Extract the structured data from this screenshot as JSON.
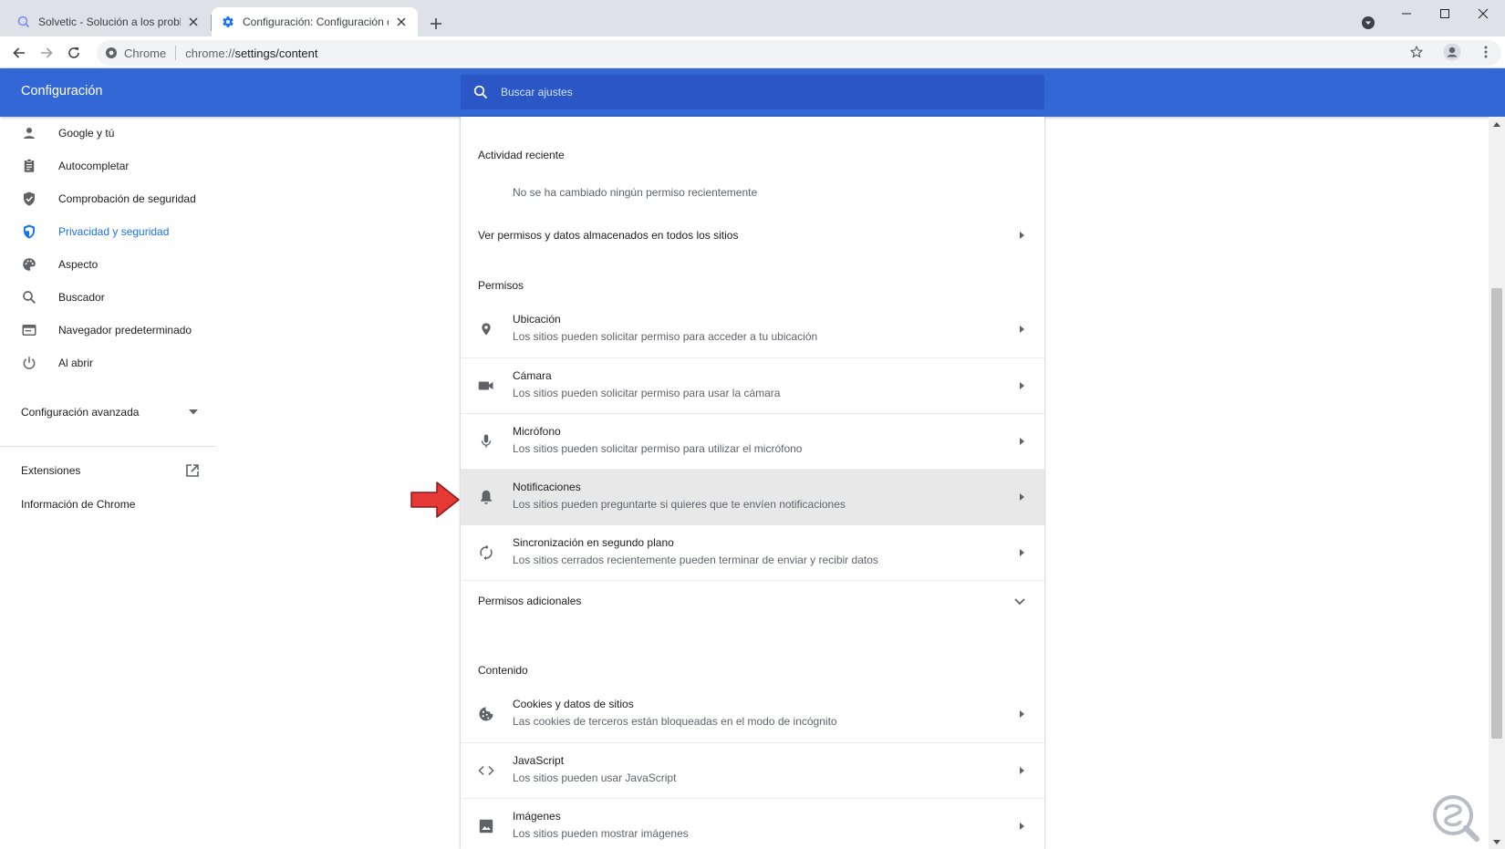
{
  "browser": {
    "tabs": [
      {
        "title": "Solvetic - Solución a los problemas",
        "active": false
      },
      {
        "title": "Configuración: Configuración de",
        "active": true
      }
    ],
    "omnibox": {
      "site_label": "Chrome",
      "url_scheme": "chrome://",
      "url_path": "settings/content"
    }
  },
  "header": {
    "title": "Configuración",
    "search_placeholder": "Buscar ajustes"
  },
  "sidebar": {
    "items": [
      {
        "label": "Google y tú",
        "icon": "person-icon",
        "selected": false
      },
      {
        "label": "Autocompletar",
        "icon": "clipboard-icon",
        "selected": false
      },
      {
        "label": "Comprobación de seguridad",
        "icon": "shield-check-icon",
        "selected": false
      },
      {
        "label": "Privacidad y seguridad",
        "icon": "shield-half-icon",
        "selected": true
      },
      {
        "label": "Aspecto",
        "icon": "palette-icon",
        "selected": false
      },
      {
        "label": "Buscador",
        "icon": "search-icon",
        "selected": false
      },
      {
        "label": "Navegador predeterminado",
        "icon": "browser-icon",
        "selected": false
      },
      {
        "label": "Al abrir",
        "icon": "power-icon",
        "selected": false
      }
    ],
    "advanced_label": "Configuración avanzada",
    "extensions_label": "Extensiones",
    "about_label": "Información de Chrome"
  },
  "main": {
    "recent_activity_title": "Actividad reciente",
    "recent_activity_text": "No se ha cambiado ningún permiso recientemente",
    "view_all_link": "Ver permisos y datos almacenados en todos los sitios",
    "permissions_title": "Permisos",
    "permissions": [
      {
        "title": "Ubicación",
        "desc": "Los sitios pueden solicitar permiso para acceder a tu ubicación",
        "icon": "location-pin-icon"
      },
      {
        "title": "Cámara",
        "desc": "Los sitios pueden solicitar permiso para usar la cámara",
        "icon": "camera-icon"
      },
      {
        "title": "Micrófono",
        "desc": "Los sitios pueden solicitar permiso para utilizar el micrófono",
        "icon": "microphone-icon"
      },
      {
        "title": "Notificaciones",
        "desc": "Los sitios pueden preguntarte si quieres que te envíen notificaciones",
        "icon": "bell-icon",
        "highlighted": true
      },
      {
        "title": "Sincronización en segundo plano",
        "desc": "Los sitios cerrados recientemente pueden terminar de enviar y recibir datos",
        "icon": "sync-icon"
      }
    ],
    "additional_permissions_label": "Permisos adicionales",
    "content_title": "Contenido",
    "content_items": [
      {
        "title": "Cookies y datos de sitios",
        "desc": "Las cookies de terceros están bloqueadas en el modo de incógnito",
        "icon": "cookie-icon"
      },
      {
        "title": "JavaScript",
        "desc": "Los sitios pueden usar JavaScript",
        "icon": "code-icon"
      },
      {
        "title": "Imágenes",
        "desc": "Los sitios pueden mostrar imágenes",
        "icon": "image-icon"
      }
    ]
  },
  "colors": {
    "header_blue": "#3367d6",
    "search_blue": "#2a56c6",
    "selected_blue": "#1a73e8",
    "highlight_row": "#e8e8e8",
    "annotation_red": "#e53935"
  }
}
